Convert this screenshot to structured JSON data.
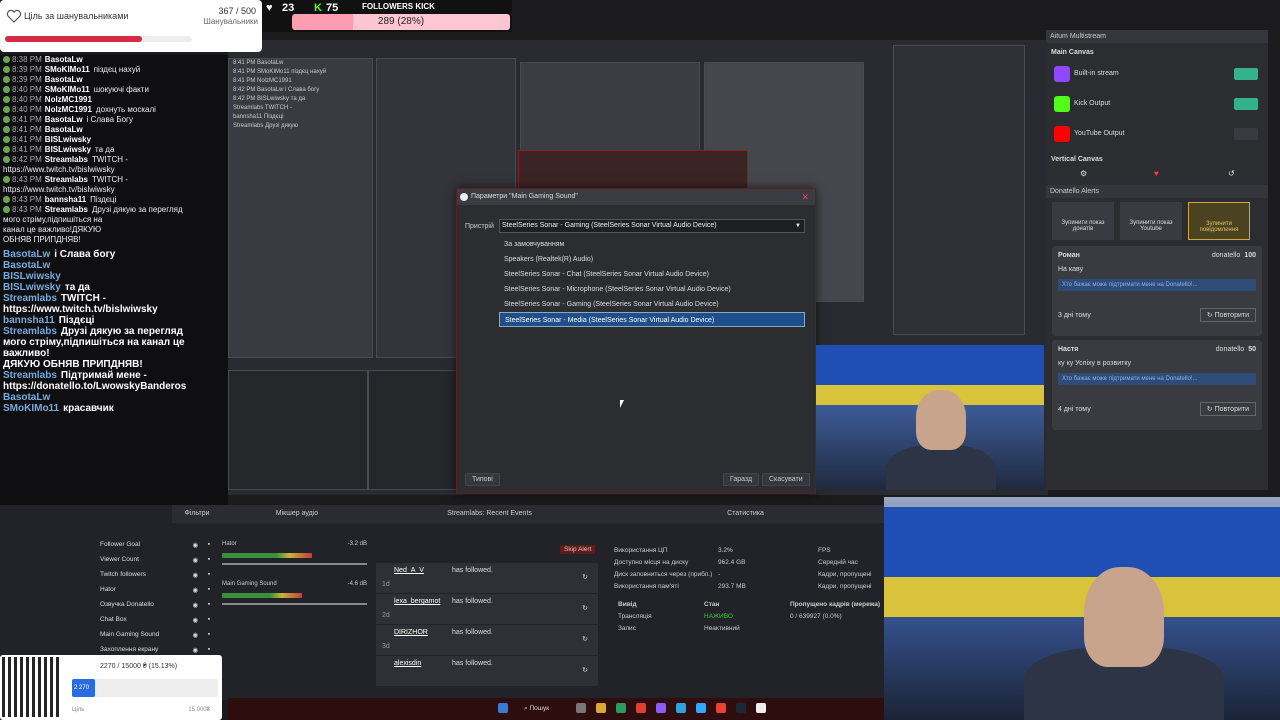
{
  "goal": {
    "title": "Ціль за шанувальниками",
    "count": "367 / 500",
    "subtitle": "Шанувальники",
    "progress": 0.734
  },
  "kick_bar": {
    "twitch_count": "23",
    "kick_count": "75",
    "label": "FOLLOWERS KICK",
    "progress_text": "289 (28%)",
    "progress": 0.28
  },
  "chat": {
    "rows": [
      {
        "time": "8:38 PM",
        "user": "BasotaLw",
        "msg": ""
      },
      {
        "time": "8:39 PM",
        "user": "SMoKIMo11",
        "msg": "піздєц нахуй"
      },
      {
        "time": "8:39 PM",
        "user": "BasotaLw",
        "msg": ""
      },
      {
        "time": "8:40 PM",
        "user": "SMoKIMo11",
        "msg": "шокуючі факти"
      },
      {
        "time": "8:40 PM",
        "user": "NolzMC1991",
        "msg": ""
      },
      {
        "time": "8:40 PM",
        "user": "NolzMC1991",
        "msg": "дохнуть москалі"
      },
      {
        "time": "8:41 PM",
        "user": "BasotaLw",
        "msg": "і Слава Богу"
      },
      {
        "time": "8:41 PM",
        "user": "BasotaLw",
        "msg": ""
      },
      {
        "time": "8:41 PM",
        "user": "BISLwiwsky",
        "msg": ""
      },
      {
        "time": "8:41 PM",
        "user": "BISLwiwsky",
        "msg": "та да"
      },
      {
        "time": "8:42 PM",
        "user": "Streamlabs",
        "msg": "TWITCH -"
      },
      {
        "time": "",
        "user": "",
        "msg": "https://www.twitch.tv/bislwiwsky"
      },
      {
        "time": "8:43 PM",
        "user": "Streamlabs",
        "msg": "TWITCH -"
      },
      {
        "time": "",
        "user": "",
        "msg": "https://www.twitch.tv/bislwiwsky"
      },
      {
        "time": "8:43 PM",
        "user": "bannsha11",
        "msg": "Піздєці"
      },
      {
        "time": "8:43 PM",
        "user": "Streamlabs",
        "msg": "Друзі дякую за перегляд"
      },
      {
        "time": "",
        "user": "",
        "msg": "мого стріму,підпишіться на"
      },
      {
        "time": "",
        "user": "",
        "msg": "канал це важливо!ДЯКУЮ"
      },
      {
        "time": "",
        "user": "",
        "msg": "ОБНЯВ ПРИПДНЯВ!"
      }
    ],
    "big_rows": [
      {
        "user": "BasotaLw",
        "msg": "і Слава богу"
      },
      {
        "user": "BasotaLw",
        "msg": ""
      },
      {
        "user": "BISLwiwsky",
        "msg": ""
      },
      {
        "user": "BISLwiwsky",
        "msg": "та да"
      },
      {
        "user": "Streamlabs",
        "msg": "TWITCH -"
      },
      {
        "user": "",
        "msg": "https://www.twitch.tv/bislwiwsky"
      },
      {
        "user": "bannsha11",
        "msg": "Піздєці"
      },
      {
        "user": "Streamlabs",
        "msg": "Друзі дякую за перегляд"
      },
      {
        "user": "",
        "msg": "мого стріму,підпишіться на канал це важливо!"
      },
      {
        "user": "",
        "msg": "ДЯКУЮ ОБНЯВ ПРИПДНЯВ!"
      },
      {
        "user": "Streamlabs",
        "msg": "Підтримай мене -"
      },
      {
        "user": "",
        "msg": "https://donatello.to/LwowskyBanderos"
      },
      {
        "user": "BasotaLw",
        "msg": ""
      },
      {
        "user": "SMoKIMo11",
        "msg": "красавчик"
      }
    ]
  },
  "dialog": {
    "title": "Параметри \"Main Gaming Sound\"",
    "device_label": "Пристрій",
    "selected": "SteelSeries Sonar - Gaming (SteelSeries Sonar Virtual Audio Device)",
    "options": [
      "За замовчуванням",
      "Speakers (Realtek(R) Audio)",
      "SteelSeries Sonar - Chat (SteelSeries Sonar Virtual Audio Device)",
      "SteelSeries Sonar - Microphone (SteelSeries Sonar Virtual Audio Device)",
      "SteelSeries Sonar - Gaming (SteelSeries Sonar Virtual Audio Device)",
      "SteelSeries Sonar - Media (SteelSeries Sonar Virtual Audio Device)"
    ],
    "highlighted_index": 5,
    "defaults_btn": "Типові",
    "ok_btn": "Гаразд",
    "cancel_btn": "Скасувати"
  },
  "multistream": {
    "title": "Aitum Multistream",
    "main_canvas": "Main Canvas",
    "outputs": [
      {
        "label": "Built-in stream",
        "color": "#9146ff"
      },
      {
        "label": "Kick Output",
        "color": "#53fc18"
      },
      {
        "label": "YouTube Output",
        "color": "#ff0000"
      }
    ],
    "vertical_canvas": "Vertical Canvas"
  },
  "donatello": {
    "title": "Donatello Alerts",
    "buttons": [
      "Зупинити показ донатів",
      "Зупинити показ Youtube",
      "Зупинити повідомлення"
    ],
    "hint": "Хто бажає може підтримати мене на Donatello!...",
    "cards": [
      {
        "name": "Роман",
        "source": "donatello",
        "amount": "100",
        "text": "На каву",
        "ago": "3 дні тому",
        "repeat": "Повторити"
      },
      {
        "name": "Настя",
        "source": "donatello",
        "amount": "50",
        "text": "ку ку Успіху в розвитку",
        "ago": "4 дні тому",
        "repeat": "Повторити"
      }
    ]
  },
  "docks": {
    "filters_label": "Фільтри",
    "mixer_title": "Мікшер аудіо",
    "events_title": "Streamlabs: Recent Events",
    "stats_title": "Статистика",
    "skip_alert": "Skip Alert",
    "sources": [
      "Follower Goal",
      "Viewer Count",
      "Twitch followers",
      "Hator",
      "Озвучка Donatello",
      "Chat Box",
      "Main Gaming Sound",
      "Захоплення екрану"
    ],
    "mixer": [
      {
        "name": "Hator",
        "db": "-3.2 dB",
        "level": 0.62
      },
      {
        "name": "Main Gaming Sound",
        "db": "-4.6 dB",
        "level": 0.55
      }
    ],
    "events": [
      {
        "user": "Ned_A_V",
        "text": "has followed.",
        "ago": "1d"
      },
      {
        "user": "lexa_bergamot",
        "text": "has followed.",
        "ago": "2d"
      },
      {
        "user": "DIRIZHOR",
        "text": "has followed.",
        "ago": "3d"
      },
      {
        "user": "alexisdin",
        "text": "has followed.",
        "ago": ""
      }
    ],
    "stats": [
      {
        "k": "Використання ЦП",
        "v": "3.2%"
      },
      {
        "k": "Доступно місця на диску",
        "v": "962.4 GB"
      },
      {
        "k": "Диск заповниться через (прибл.)",
        "v": "-"
      },
      {
        "k": "Використання пам'яті",
        "v": "293.7 MB"
      }
    ],
    "stats_right": [
      "FPS",
      "Середній час",
      "Кадри, пропущені",
      "Кадри, пропущені"
    ],
    "output_head": [
      "Вивід",
      "Стан",
      "Пропущено кадрів (мережа)"
    ],
    "outputs": [
      {
        "name": "Трансляція",
        "state": "НАЖИВО",
        "dropped": "0 / 639927 (0.0%)"
      },
      {
        "name": "Запис",
        "state": "Неактивний",
        "dropped": ""
      }
    ]
  },
  "donation_widget": {
    "amount": "2270 / 15000 ₴ (15.13%)",
    "bar_label": "2 270",
    "progress": 0.1513,
    "goal_label": "Ціль",
    "total": "15 000₴"
  },
  "taskbar": {
    "search": "Пошук"
  }
}
